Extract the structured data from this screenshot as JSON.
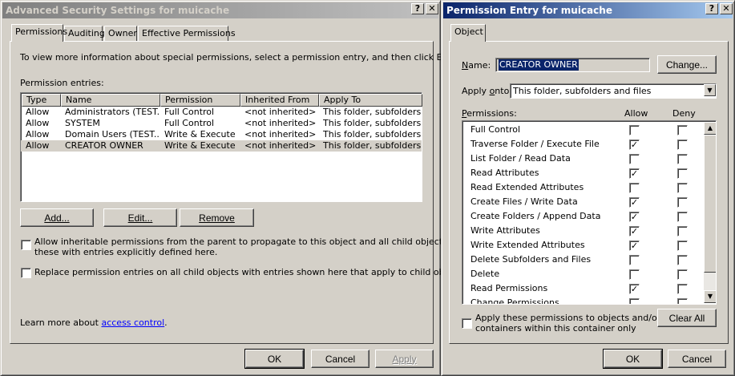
{
  "left": {
    "title": "Advanced Security Settings for muicache",
    "tabs": [
      "Permissions",
      "Auditing",
      "Owner",
      "Effective Permissions"
    ],
    "info_text": "To view more information about special permissions, select a permission entry, and then click Edit.",
    "entries_label": "Permission entries:",
    "columns": [
      "Type",
      "Name",
      "Permission",
      "Inherited From",
      "Apply To"
    ],
    "rows": [
      [
        "Allow",
        "Administrators (TEST...",
        "Full Control",
        "<not inherited>",
        "This folder, subfolders..."
      ],
      [
        "Allow",
        "SYSTEM",
        "Full Control",
        "<not inherited>",
        "This folder, subfolders..."
      ],
      [
        "Allow",
        "Domain Users (TEST...",
        "Write & Execute",
        "<not inherited>",
        "This folder, subfolders..."
      ],
      [
        "Allow",
        "CREATOR OWNER",
        "Write & Execute",
        "<not inherited>",
        "This folder, subfolders..."
      ]
    ],
    "add_label": "Add...",
    "edit_label": "Edit...",
    "remove_label": "Remove",
    "inherit_line1": "Allow inheritable permissions from the parent to propagate to this object and all child objects. Include",
    "inherit_line2": "these with entries explicitly defined here.",
    "replace_text": "Replace permission entries on all child objects with entries shown here that apply to child objects",
    "learn_prefix": "Learn more about ",
    "learn_link": "access control",
    "learn_suffix": ".",
    "ok_label": "OK",
    "cancel_label": "Cancel",
    "apply_label": "Apply"
  },
  "right": {
    "title": "Permission Entry for muicache",
    "tab": "Object",
    "name_label": "Name:",
    "name_value": "CREATOR OWNER",
    "change_label": "Change...",
    "apply_onto_label": "Apply onto:",
    "apply_onto_value": "This folder, subfolders and files",
    "permissions_label": "Permissions:",
    "allow_label": "Allow",
    "deny_label": "Deny",
    "permissions": [
      {
        "name": "Full Control",
        "allow": false,
        "deny": false
      },
      {
        "name": "Traverse Folder / Execute File",
        "allow": true,
        "deny": false
      },
      {
        "name": "List Folder / Read Data",
        "allow": false,
        "deny": false
      },
      {
        "name": "Read Attributes",
        "allow": true,
        "deny": false
      },
      {
        "name": "Read Extended Attributes",
        "allow": false,
        "deny": false
      },
      {
        "name": "Create Files / Write Data",
        "allow": true,
        "deny": false
      },
      {
        "name": "Create Folders / Append Data",
        "allow": true,
        "deny": false
      },
      {
        "name": "Write Attributes",
        "allow": true,
        "deny": false
      },
      {
        "name": "Write Extended Attributes",
        "allow": true,
        "deny": false
      },
      {
        "name": "Delete Subfolders and Files",
        "allow": false,
        "deny": false
      },
      {
        "name": "Delete",
        "allow": false,
        "deny": false
      },
      {
        "name": "Read Permissions",
        "allow": true,
        "deny": false
      },
      {
        "name": "Change Permissions",
        "allow": false,
        "deny": false
      }
    ],
    "apply_only_line1": "Apply these permissions to objects and/or",
    "apply_only_line2": "containers within this container only",
    "clear_all_label": "Clear All",
    "ok_label": "OK",
    "cancel_label": "Cancel"
  }
}
